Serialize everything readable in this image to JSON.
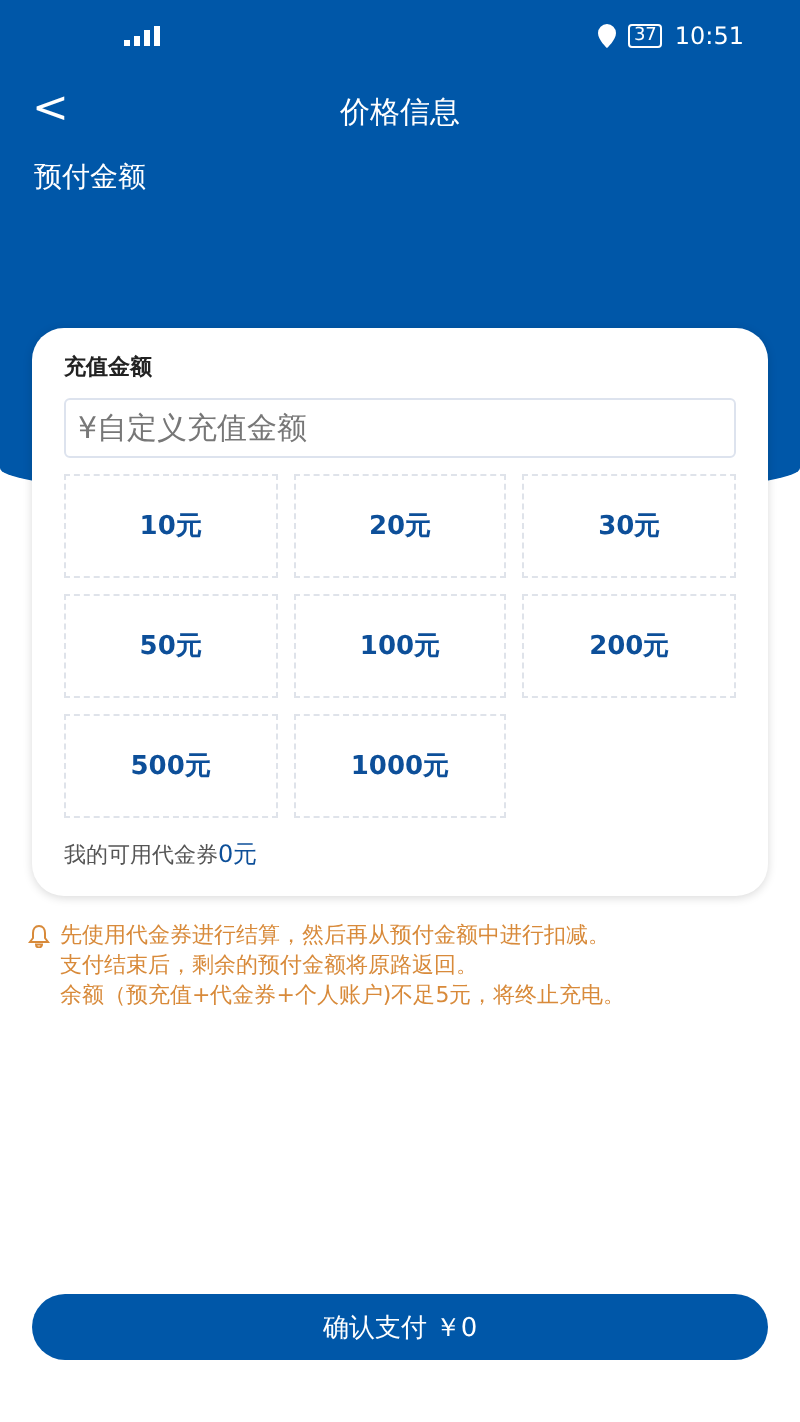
{
  "status_bar": {
    "battery": "37",
    "time": "10:51"
  },
  "header": {
    "title": "价格信息",
    "back": "<"
  },
  "section_title": "预付金额",
  "card": {
    "title": "充值金额",
    "input": {
      "placeholder": "¥自定义充值金额"
    },
    "amounts": [
      {
        "label": "10元",
        "selected": false
      },
      {
        "label": "20元",
        "selected": false
      },
      {
        "label": "30元",
        "selected": false
      },
      {
        "label": "50元",
        "selected": false
      },
      {
        "label": "100元",
        "selected": false
      },
      {
        "label": "200元",
        "selected": false
      },
      {
        "label": "500元",
        "selected": false
      },
      {
        "label": "1000元",
        "selected": false
      }
    ],
    "voucher_label": "我的可用代金券",
    "voucher_value": "0元"
  },
  "notes": [
    "先使用代金券进行结算，然后再从预付金额中进行扣减。",
    "支付结束后，剩余的预付金额将原路返回。",
    "余额（预充值+代金券+个人账户)不足5元，将终止充电。"
  ],
  "confirm_button": "确认支付 ￥0"
}
